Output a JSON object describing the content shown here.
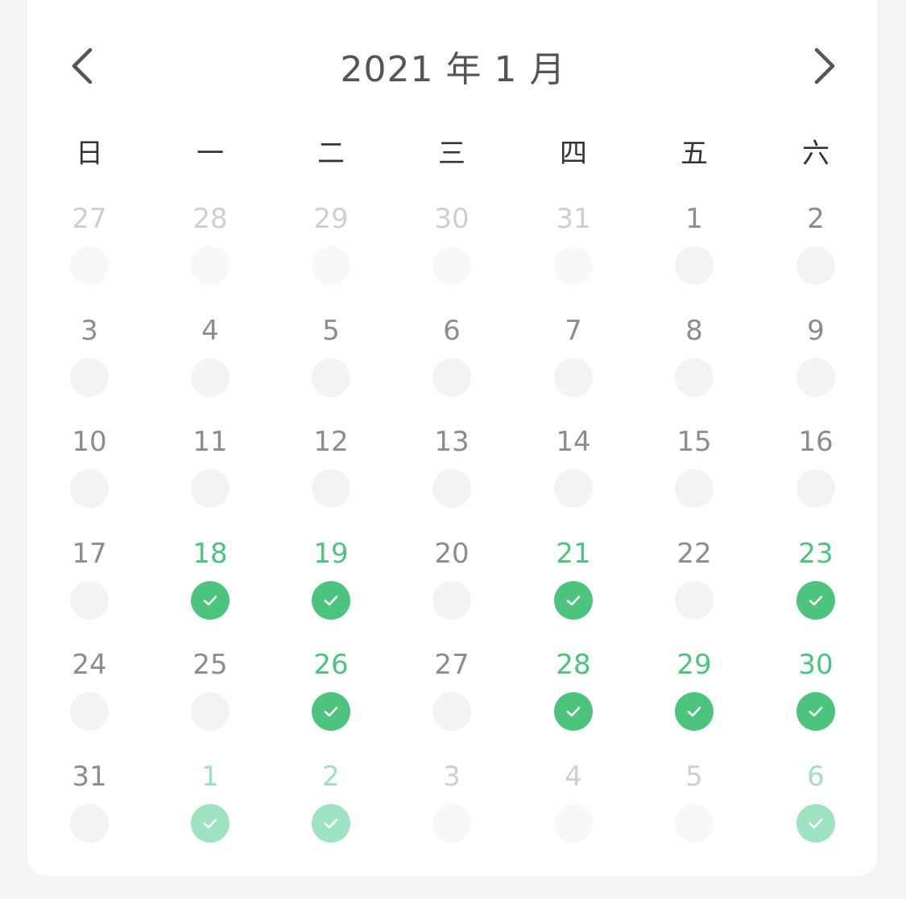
{
  "calendar": {
    "title": "2021 年 1 月",
    "prev_icon": "chevron-left-icon",
    "next_icon": "chevron-right-icon",
    "weekdays": [
      "日",
      "一",
      "二",
      "三",
      "四",
      "五",
      "六"
    ],
    "accent_color": "#4cc47e",
    "weeks": [
      [
        {
          "day": "27",
          "other_month": true,
          "done": false
        },
        {
          "day": "28",
          "other_month": true,
          "done": false
        },
        {
          "day": "29",
          "other_month": true,
          "done": false
        },
        {
          "day": "30",
          "other_month": true,
          "done": false
        },
        {
          "day": "31",
          "other_month": true,
          "done": false
        },
        {
          "day": "1",
          "other_month": false,
          "done": false
        },
        {
          "day": "2",
          "other_month": false,
          "done": false
        }
      ],
      [
        {
          "day": "3",
          "other_month": false,
          "done": false
        },
        {
          "day": "4",
          "other_month": false,
          "done": false
        },
        {
          "day": "5",
          "other_month": false,
          "done": false
        },
        {
          "day": "6",
          "other_month": false,
          "done": false
        },
        {
          "day": "7",
          "other_month": false,
          "done": false
        },
        {
          "day": "8",
          "other_month": false,
          "done": false
        },
        {
          "day": "9",
          "other_month": false,
          "done": false
        }
      ],
      [
        {
          "day": "10",
          "other_month": false,
          "done": false
        },
        {
          "day": "11",
          "other_month": false,
          "done": false
        },
        {
          "day": "12",
          "other_month": false,
          "done": false
        },
        {
          "day": "13",
          "other_month": false,
          "done": false
        },
        {
          "day": "14",
          "other_month": false,
          "done": false
        },
        {
          "day": "15",
          "other_month": false,
          "done": false
        },
        {
          "day": "16",
          "other_month": false,
          "done": false
        }
      ],
      [
        {
          "day": "17",
          "other_month": false,
          "done": false
        },
        {
          "day": "18",
          "other_month": false,
          "done": true
        },
        {
          "day": "19",
          "other_month": false,
          "done": true
        },
        {
          "day": "20",
          "other_month": false,
          "done": false
        },
        {
          "day": "21",
          "other_month": false,
          "done": true
        },
        {
          "day": "22",
          "other_month": false,
          "done": false
        },
        {
          "day": "23",
          "other_month": false,
          "done": true
        }
      ],
      [
        {
          "day": "24",
          "other_month": false,
          "done": false
        },
        {
          "day": "25",
          "other_month": false,
          "done": false
        },
        {
          "day": "26",
          "other_month": false,
          "done": true
        },
        {
          "day": "27",
          "other_month": false,
          "done": false
        },
        {
          "day": "28",
          "other_month": false,
          "done": true
        },
        {
          "day": "29",
          "other_month": false,
          "done": true
        },
        {
          "day": "30",
          "other_month": false,
          "done": true
        }
      ],
      [
        {
          "day": "31",
          "other_month": false,
          "done": false
        },
        {
          "day": "1",
          "other_month": true,
          "done": true
        },
        {
          "day": "2",
          "other_month": true,
          "done": true
        },
        {
          "day": "3",
          "other_month": true,
          "done": false
        },
        {
          "day": "4",
          "other_month": true,
          "done": false
        },
        {
          "day": "5",
          "other_month": true,
          "done": false
        },
        {
          "day": "6",
          "other_month": true,
          "done": true
        }
      ]
    ]
  }
}
